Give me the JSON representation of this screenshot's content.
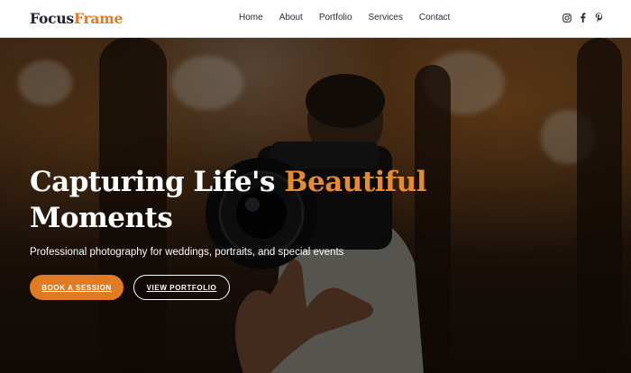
{
  "brand": {
    "part1": "Focus",
    "part2": "Frame",
    "accent_color": "#e07b24"
  },
  "nav": {
    "items": [
      "Home",
      "About",
      "Portfolio",
      "Services",
      "Contact"
    ]
  },
  "social": {
    "icons": [
      "instagram-icon",
      "facebook-icon",
      "pinterest-icon"
    ]
  },
  "hero": {
    "headline_part1": "Capturing Life's ",
    "headline_accent": "Beautiful",
    "headline_part2": "Moments",
    "subtitle": "Professional photography for weddings, portraits, and special events",
    "primary_button": "BOOK A SESSION",
    "secondary_button": "VIEW PORTFOLIO"
  }
}
